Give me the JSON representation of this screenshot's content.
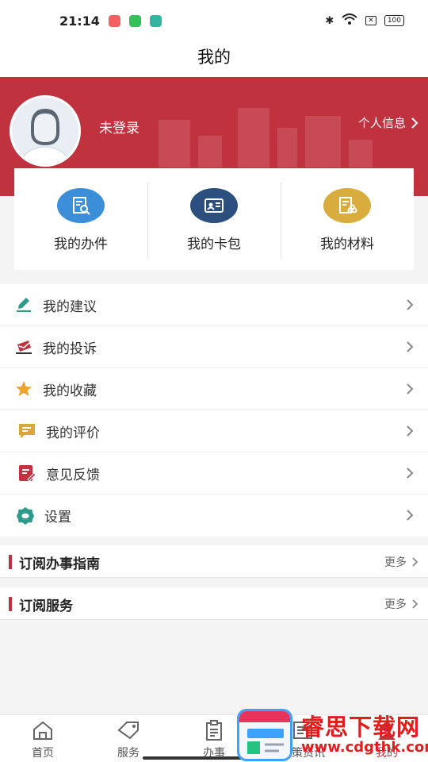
{
  "status_bar": {
    "time": "21:14",
    "battery": "100"
  },
  "header": {
    "title": "我的"
  },
  "profile": {
    "login_status": "未登录",
    "info_link": "个人信息"
  },
  "quick_actions": [
    {
      "label": "我的办件",
      "icon": "search-document-icon",
      "color": "#3a8fd8"
    },
    {
      "label": "我的卡包",
      "icon": "id-card-icon",
      "color": "#2c4f7f"
    },
    {
      "label": "我的材料",
      "icon": "materials-icon",
      "color": "#d8ac3d"
    }
  ],
  "menu": [
    {
      "label": "我的建议",
      "icon": "pencil-icon",
      "color": "#2e9a8a"
    },
    {
      "label": "我的投诉",
      "icon": "complaint-icon",
      "color": "#c1323f"
    },
    {
      "label": "我的收藏",
      "icon": "star-icon",
      "color": "#f0a32b"
    },
    {
      "label": "我的评价",
      "icon": "comment-icon",
      "color": "#d9a63c"
    },
    {
      "label": "意见反馈",
      "icon": "feedback-icon",
      "color": "#c1323f"
    },
    {
      "label": "设置",
      "icon": "settings-icon",
      "color": "#2e9a8a"
    }
  ],
  "subscriptions": [
    {
      "title": "订阅办事指南",
      "more": "更多"
    },
    {
      "title": "订阅服务",
      "more": "更多"
    }
  ],
  "tabbar": {
    "items": [
      {
        "label": "首页",
        "icon": "home-icon"
      },
      {
        "label": "服务",
        "icon": "tag-icon"
      },
      {
        "label": "办事",
        "icon": "clipboard-icon"
      },
      {
        "label": "政策资讯",
        "icon": "news-icon"
      },
      {
        "label": "我的",
        "icon": "user-icon"
      }
    ]
  },
  "watermark": {
    "title": "睿思下载网",
    "url": "www.cdgthk.com"
  },
  "colors": {
    "brand": "#c1323f",
    "accent_blue": "#3ca1ff"
  }
}
